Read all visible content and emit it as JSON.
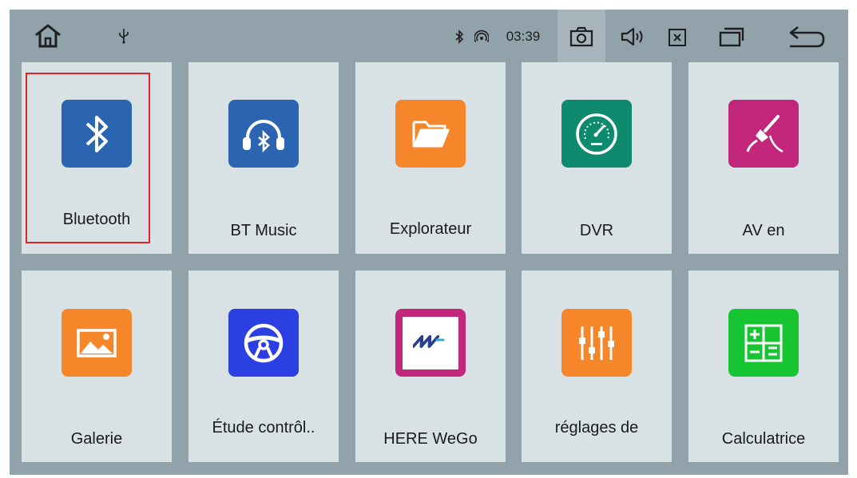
{
  "statusbar": {
    "time": "03:39",
    "icons": [
      "home-icon",
      "usb-icon",
      "bluetooth-status-icon",
      "signal-icon",
      "camera-icon",
      "volume-icon",
      "close-app-icon",
      "recent-apps-icon",
      "back-icon"
    ]
  },
  "apps": [
    {
      "label": "Bluetooth",
      "icon": "bluetooth-icon",
      "color": "#2b64b1"
    },
    {
      "label": "BT Music",
      "icon": "bt-music-icon",
      "color": "#2b64b1"
    },
    {
      "label": "Explorateur",
      "icon": "folder-icon",
      "color": "#f5862a"
    },
    {
      "label": "DVR",
      "icon": "speedometer-icon",
      "color": "#0e8a6e"
    },
    {
      "label": "AV en",
      "icon": "av-cable-icon",
      "color": "#c2277b"
    },
    {
      "label": "Galerie",
      "icon": "image-icon",
      "color": "#f5862a"
    },
    {
      "label": "Étude contrôl..",
      "icon": "steering-wheel-icon",
      "color": "#2c3fe3"
    },
    {
      "label": "HERE WeGo",
      "icon": "here-wego-icon",
      "color": "#c2277b"
    },
    {
      "label": "réglages de",
      "icon": "equalizer-icon",
      "color": "#f5862a"
    },
    {
      "label": "Calculatrice",
      "icon": "calculator-icon",
      "color": "#17c431"
    }
  ]
}
